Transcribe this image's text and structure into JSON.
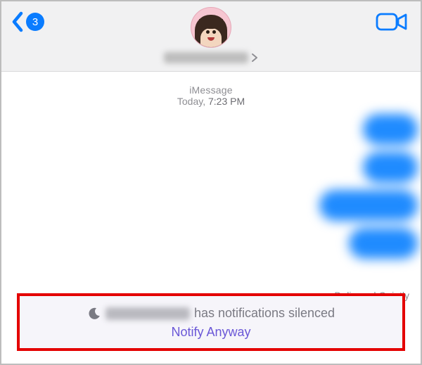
{
  "header": {
    "back_badge": "3",
    "contact_name": "████████"
  },
  "thread": {
    "service": "iMessage",
    "date_label": "Today,",
    "time": "7:23 PM",
    "bubbles_widths": [
      78,
      78,
      140,
      98
    ],
    "delivered_label": "Delivered Quietly"
  },
  "silenced": {
    "text_suffix": "has notifications silenced",
    "notify_label": "Notify Anyway"
  }
}
